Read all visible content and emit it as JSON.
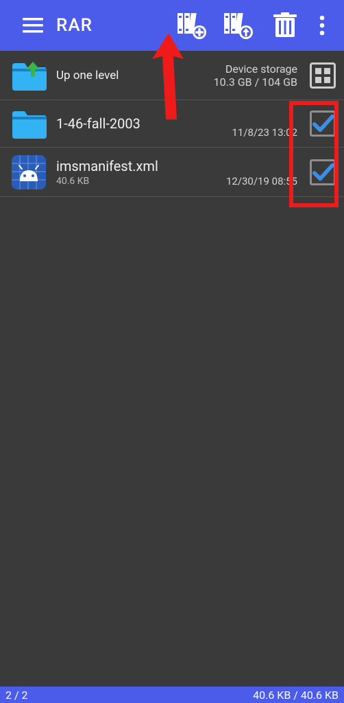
{
  "header": {
    "title": "RAR"
  },
  "storage": {
    "label": "Device storage",
    "value": "10.3 GB / 104 GB",
    "up_label": "Up one level"
  },
  "items": [
    {
      "name": "1-46-fall-2003",
      "date": "11/8/23 13:02",
      "size": "",
      "type": "folder",
      "checked": true
    },
    {
      "name": "imsmanifest.xml",
      "date": "12/30/19 08:55",
      "size": "40.6 KB",
      "type": "xml",
      "checked": true
    }
  ],
  "footer": {
    "count": "2 / 2",
    "size": "40.6 KB / 40.6 KB"
  }
}
